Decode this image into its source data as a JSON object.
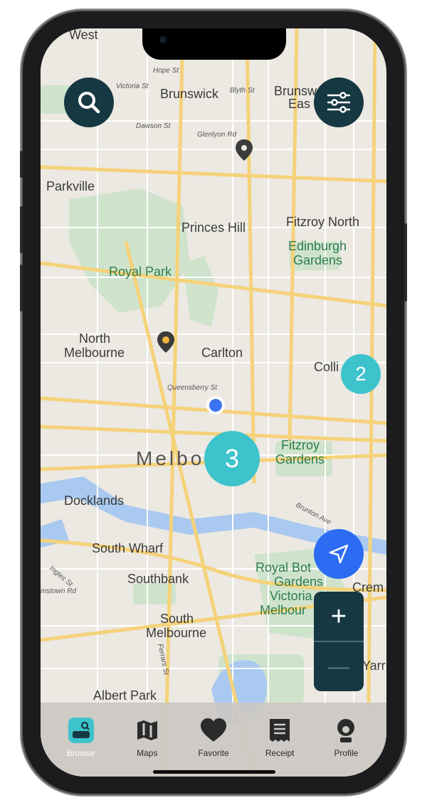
{
  "map": {
    "labels": {
      "west": "West",
      "hope_st": "Hope St",
      "victoria_st": "Victoria St",
      "brunswick": "Brunswick",
      "blyth_st": "Blyth St",
      "brunswick_east_1": "Brunsw",
      "brunswick_east_2": "Eas",
      "dawson_st": "Dawson St",
      "glenlyon_rd": "Glenlyon Rd",
      "parkville": "Parkville",
      "princes_hill": "Princes Hill",
      "fitzroy_north": "Fitzroy North",
      "edinburgh_1": "Edinburgh",
      "edinburgh_2": "Gardens",
      "royal_park": "Royal Park",
      "north_melb_1": "North",
      "north_melb_2": "Melbourne",
      "carlton": "Carlton",
      "colli": "Colli",
      "queensberry_st": "Queensberry St",
      "melbourne": "Melbo",
      "fitzroy_gardens_1": "Fitzroy",
      "fitzroy_gardens_2": "Gardens",
      "docklands": "Docklands",
      "brunton_ave": "Brunton Ave",
      "south_wharf": "South Wharf",
      "ingles_st": "Ingles St",
      "southbank": "Southbank",
      "royal_bot_1": "Royal Bot",
      "royal_bot_2": "Gardens",
      "royal_bot_3": "Victoria",
      "royal_bot_4": "Melbour",
      "crem": "Crem",
      "mstown_rd": "mstown Rd",
      "south_melb_1": "South",
      "south_melb_2": "Melbourne",
      "ferrars_st": "Ferrars St",
      "yarr": "Yarr",
      "albert_park": "Albert Park"
    },
    "clusters": {
      "large": "3",
      "small": "2"
    },
    "controls": {
      "zoom_in": "+",
      "zoom_out": "—"
    }
  },
  "tabs": [
    {
      "label": "Browse",
      "icon": "browse-icon"
    },
    {
      "label": "Maps",
      "icon": "map-icon"
    },
    {
      "label": "Favorite",
      "icon": "heart-icon"
    },
    {
      "label": "Receipt",
      "icon": "receipt-icon"
    },
    {
      "label": "Profile",
      "icon": "profile-icon"
    }
  ],
  "colors": {
    "accent": "#3dc3cc",
    "dark": "#163842",
    "location_blue": "#2c6cf2"
  }
}
